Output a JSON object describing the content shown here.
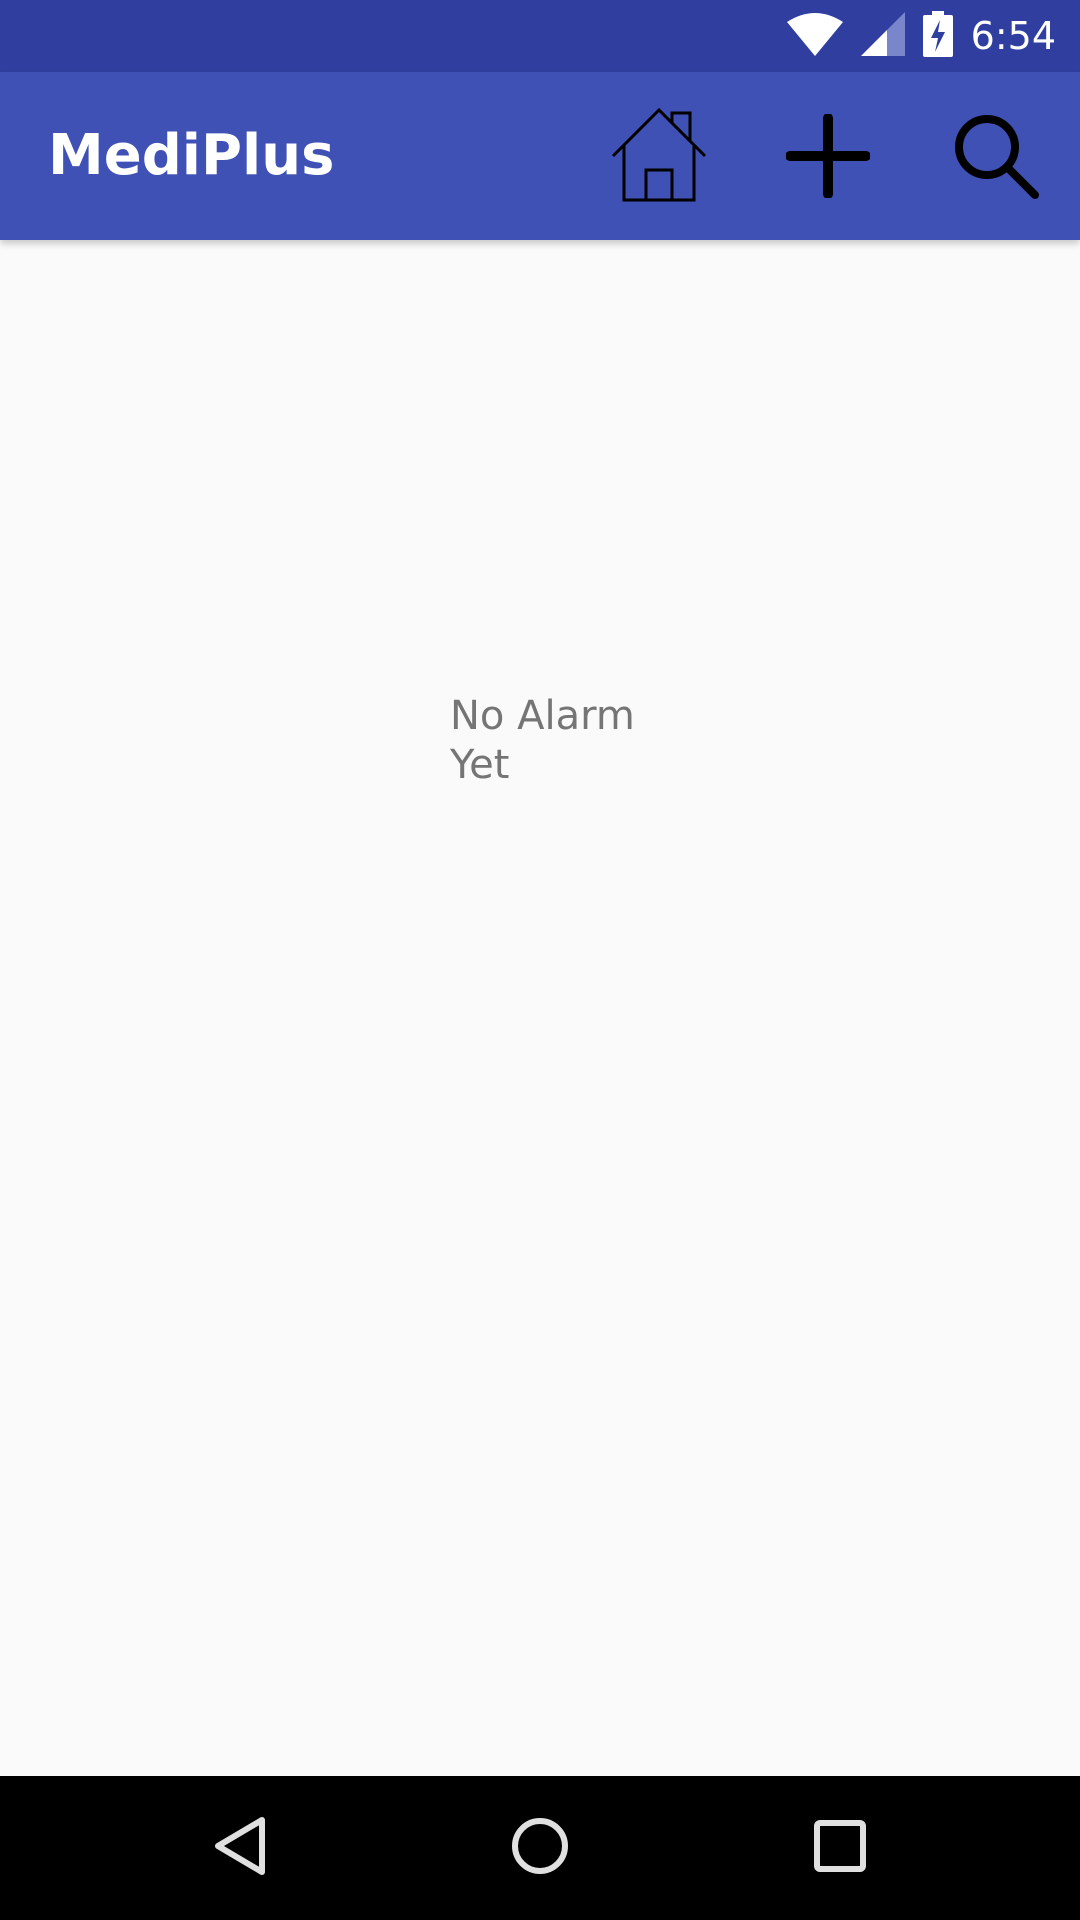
{
  "status_bar": {
    "time": "6:54",
    "icons": [
      "wifi-icon",
      "cellular-signal-icon",
      "battery-charging-icon"
    ]
  },
  "app_bar": {
    "title": "MediPlus",
    "actions": [
      "home-icon",
      "add-icon",
      "search-icon"
    ]
  },
  "content": {
    "empty_message": "No Alarm Yet"
  },
  "nav_bar": {
    "buttons": [
      "back-icon",
      "home-circle-icon",
      "recents-icon"
    ]
  },
  "colors": {
    "status_bar": "#303f9f",
    "app_bar": "#3f51b5",
    "background": "#fafafa",
    "empty_text": "#757575",
    "nav_bar": "#000000"
  }
}
